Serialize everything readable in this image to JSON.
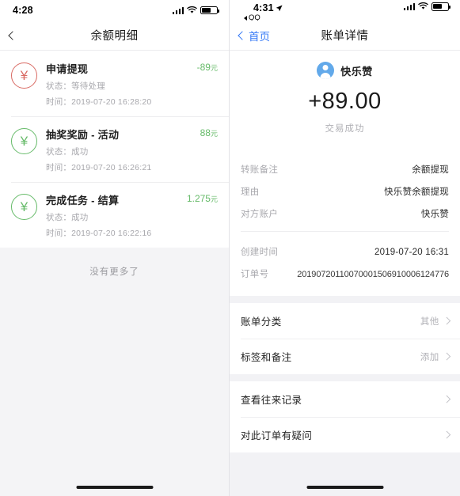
{
  "left": {
    "status_bar": {
      "time": "4:28",
      "signal_icon": "signal-bars-icon",
      "wifi_icon": "wifi-icon",
      "battery_icon": "battery-icon"
    },
    "nav": {
      "title": "余额明细",
      "back_icon": "chevron-left-icon"
    },
    "transactions": [
      {
        "icon": "yuan-coin-icon",
        "icon_color": "#d96b64",
        "title": "申请提现",
        "status": "状态：等待处理",
        "time": "时间：2019-07-20 16:28:20",
        "amount": "-89",
        "unit": "元",
        "amount_color": "#67bb6a"
      },
      {
        "icon": "yuan-coin-icon",
        "icon_color": "#67bb6a",
        "title": "抽奖奖励 - 活动",
        "status": "状态：成功",
        "time": "时间：2019-07-20 16:26:21",
        "amount": "88",
        "unit": "元",
        "amount_color": "#67bb6a"
      },
      {
        "icon": "yuan-coin-icon",
        "icon_color": "#67bb6a",
        "title": "完成任务 - 结算",
        "status": "状态：成功",
        "time": "时间：2019-07-20 16:22:16",
        "amount": "1.275",
        "unit": "元",
        "amount_color": "#67bb6a"
      }
    ],
    "footer_text": "没有更多了"
  },
  "right": {
    "status_bar": {
      "time": "4:31",
      "location_icon": "location-arrow-icon",
      "app_back": "QQ",
      "signal_icon": "signal-bars-icon",
      "wifi_icon": "wifi-icon",
      "battery_icon": "battery-icon"
    },
    "nav": {
      "back_label": "首页",
      "title": "账单详情",
      "back_icon": "chevron-left-icon"
    },
    "hero": {
      "avatar_icon": "user-avatar-icon",
      "name": "快乐赞",
      "amount": "+89.00",
      "status": "交易成功"
    },
    "details_group_1": [
      {
        "key": "转账备注",
        "value": "余额提现"
      },
      {
        "key": "理由",
        "value": "快乐赞余额提现"
      },
      {
        "key": "对方账户",
        "value": "快乐赞"
      }
    ],
    "details_group_2": [
      {
        "key": "创建时间",
        "value": "2019-07-20 16:31"
      },
      {
        "key": "订单号",
        "value": "20190720110070001506910006124776"
      }
    ],
    "actions_group_1": [
      {
        "label": "账单分类",
        "value": "其他",
        "chevron": "chevron-right-icon"
      },
      {
        "label": "标签和备注",
        "value": "添加",
        "chevron": "chevron-right-icon"
      }
    ],
    "actions_group_2": [
      {
        "label": "查看往来记录",
        "value": "",
        "chevron": "chevron-right-icon"
      },
      {
        "label": "对此订单有疑问",
        "value": "",
        "chevron": "chevron-right-icon"
      }
    ]
  }
}
